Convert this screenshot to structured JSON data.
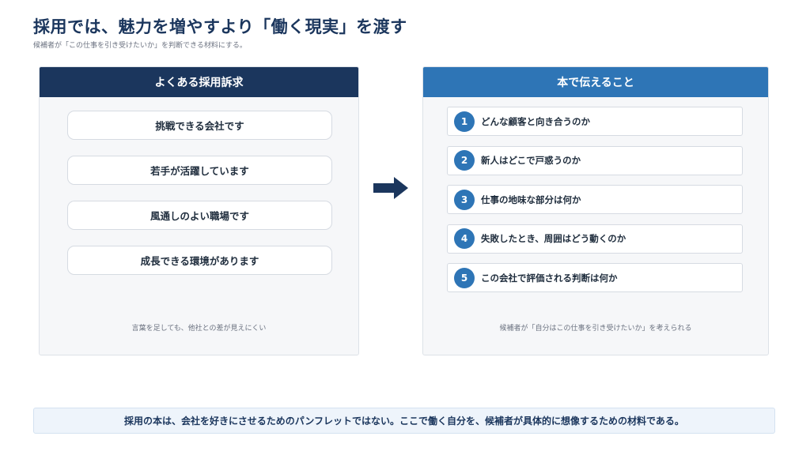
{
  "header": {
    "title": "採用では、魅力を増やすより「働く現実」を渡す",
    "subtitle": "候補者が「この仕事を引き受けたいか」を判断できる材料にする。"
  },
  "left_panel": {
    "title": "よくある採用訴求",
    "items": [
      "挑戦できる会社です",
      "若手が活躍しています",
      "風通しのよい職場です",
      "成長できる環境があります"
    ],
    "note": "言葉を足しても、他社との差が見えにくい"
  },
  "right_panel": {
    "title": "本で伝えること",
    "items": [
      {
        "number": "1",
        "text": "どんな顧客と向き合うのか"
      },
      {
        "number": "2",
        "text": "新人はどこで戸惑うのか"
      },
      {
        "number": "3",
        "text": "仕事の地味な部分は何か"
      },
      {
        "number": "4",
        "text": "失敗したとき、周囲はどう動くのか"
      },
      {
        "number": "5",
        "text": "この会社で評価される判断は何か"
      }
    ],
    "note": "候補者が「自分はこの仕事を引き受けたいか」を考えられる"
  },
  "arrow": {
    "icon": "right-arrow-icon",
    "color": "#1b365d"
  },
  "footer": {
    "message": "採用の本は、会社を好きにさせるためのパンフレットではない。ここで働く自分を、候補者が具体的に想像するための材料である。"
  },
  "colors": {
    "navy": "#1b365d",
    "blue": "#2e75b6",
    "panel_bg": "#f6f7f9"
  }
}
